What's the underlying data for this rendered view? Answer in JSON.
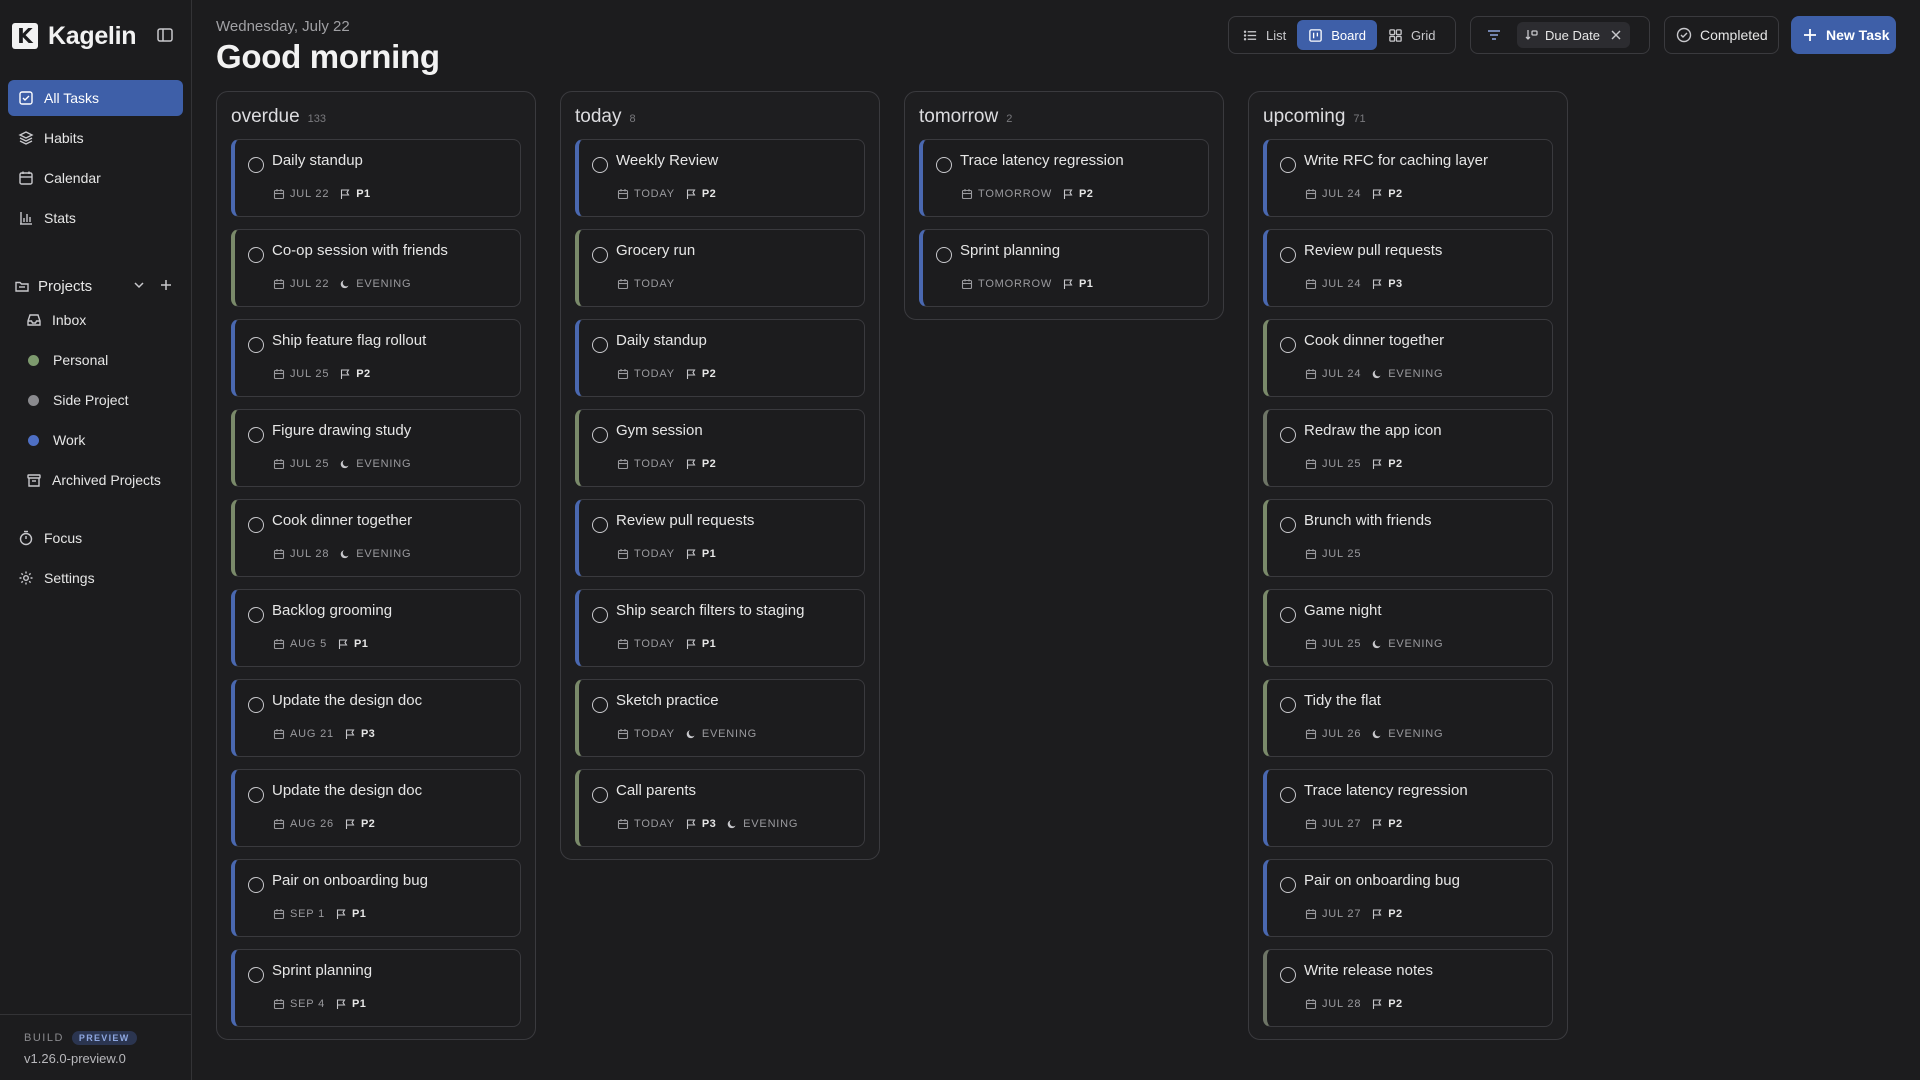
{
  "app": {
    "name": "Kagelin",
    "logo_letter": "K"
  },
  "sidebar": {
    "nav": [
      {
        "label": "All Tasks",
        "icon": "check-square-icon",
        "active": true
      },
      {
        "label": "Habits",
        "icon": "layers-icon"
      },
      {
        "label": "Calendar",
        "icon": "calendar-icon"
      },
      {
        "label": "Stats",
        "icon": "bar-chart-icon"
      }
    ],
    "projects_label": "Projects",
    "projects": [
      {
        "label": "Inbox",
        "icon": "inbox-icon"
      },
      {
        "label": "Personal",
        "color": "#7d9a6e"
      },
      {
        "label": "Side Project",
        "color": "#8a8a8e"
      },
      {
        "label": "Work",
        "color": "#4e6fc4"
      },
      {
        "label": "Archived Projects",
        "icon": "archive-icon"
      }
    ],
    "nav2": [
      {
        "label": "Focus",
        "icon": "timer-icon"
      },
      {
        "label": "Settings",
        "icon": "gear-icon"
      }
    ],
    "build_label": "BUILD",
    "build_badge": "PREVIEW",
    "version": "v1.26.0-preview.0"
  },
  "header": {
    "date": "Wednesday, July 22",
    "greeting": "Good morning"
  },
  "toolbar": {
    "views": [
      {
        "label": "List",
        "icon": "list-icon"
      },
      {
        "label": "Board",
        "icon": "board-icon",
        "active": true
      },
      {
        "label": "Grid",
        "icon": "grid-icon"
      }
    ],
    "sort_chip": "Due Date",
    "completed_label": "Completed",
    "new_task_label": "New Task"
  },
  "colors": {
    "accent": "#3e5fa8",
    "bg": "#1c1c1e",
    "border": "#3a3a3e"
  },
  "columns": [
    {
      "title": "overdue",
      "count": "133",
      "cards": [
        {
          "title": "Daily standup",
          "date": "JUL 22",
          "priority": "P1",
          "kind": "work"
        },
        {
          "title": "Co-op session with friends",
          "date": "JUL 22",
          "evening": "EVENING",
          "kind": "evening"
        },
        {
          "title": "Ship feature flag rollout",
          "date": "JUL 25",
          "priority": "P2",
          "kind": "work"
        },
        {
          "title": "Figure drawing study",
          "date": "JUL 25",
          "evening": "EVENING",
          "kind": "evening"
        },
        {
          "title": "Cook dinner together",
          "date": "JUL 28",
          "evening": "EVENING",
          "kind": "evening"
        },
        {
          "title": "Backlog grooming",
          "date": "AUG 5",
          "priority": "P1",
          "kind": "work"
        },
        {
          "title": "Update the design doc",
          "date": "AUG 21",
          "priority": "P3",
          "kind": "work"
        },
        {
          "title": "Update the design doc",
          "date": "AUG 26",
          "priority": "P2",
          "kind": "work"
        },
        {
          "title": "Pair on onboarding bug",
          "date": "SEP 1",
          "priority": "P1",
          "kind": "work"
        },
        {
          "title": "Sprint planning",
          "date": "SEP 4",
          "priority": "P1",
          "kind": "work"
        }
      ]
    },
    {
      "title": "today",
      "count": "8",
      "cards": [
        {
          "title": "Weekly Review",
          "date": "TODAY",
          "priority": "P2",
          "kind": "work"
        },
        {
          "title": "Grocery run",
          "date": "TODAY",
          "kind": "evening"
        },
        {
          "title": "Daily standup",
          "date": "TODAY",
          "priority": "P2",
          "kind": "work"
        },
        {
          "title": "Gym session",
          "date": "TODAY",
          "priority": "P2",
          "kind": "evening"
        },
        {
          "title": "Review pull requests",
          "date": "TODAY",
          "priority": "P1",
          "kind": "work"
        },
        {
          "title": "Ship search filters to staging",
          "date": "TODAY",
          "priority": "P1",
          "kind": "work"
        },
        {
          "title": "Sketch practice",
          "date": "TODAY",
          "evening": "EVENING",
          "kind": "evening"
        },
        {
          "title": "Call parents",
          "date": "TODAY",
          "priority": "P3",
          "evening": "EVENING",
          "kind": "evening"
        }
      ]
    },
    {
      "title": "tomorrow",
      "count": "2",
      "cards": [
        {
          "title": "Trace latency regression",
          "date": "TOMORROW",
          "priority": "P2",
          "kind": "work"
        },
        {
          "title": "Sprint planning",
          "date": "TOMORROW",
          "priority": "P1",
          "kind": "work"
        }
      ]
    },
    {
      "title": "upcoming",
      "count": "71",
      "cards": [
        {
          "title": "Write RFC for caching layer",
          "date": "JUL 24",
          "priority": "P2",
          "kind": "work"
        },
        {
          "title": "Review pull requests",
          "date": "JUL 24",
          "priority": "P3",
          "kind": "work"
        },
        {
          "title": "Cook dinner together",
          "date": "JUL 24",
          "evening": "EVENING",
          "kind": "evening"
        },
        {
          "title": "Redraw the app icon",
          "date": "JUL 25",
          "priority": "P2",
          "kind": "plain"
        },
        {
          "title": "Brunch with friends",
          "date": "JUL 25",
          "kind": "evening"
        },
        {
          "title": "Game night",
          "date": "JUL 25",
          "evening": "EVENING",
          "kind": "evening"
        },
        {
          "title": "Tidy the flat",
          "date": "JUL 26",
          "evening": "EVENING",
          "kind": "evening"
        },
        {
          "title": "Trace latency regression",
          "date": "JUL 27",
          "priority": "P2",
          "kind": "work"
        },
        {
          "title": "Pair on onboarding bug",
          "date": "JUL 27",
          "priority": "P2",
          "kind": "work"
        },
        {
          "title": "Write release notes",
          "date": "JUL 28",
          "priority": "P2",
          "kind": "plain"
        }
      ]
    }
  ]
}
